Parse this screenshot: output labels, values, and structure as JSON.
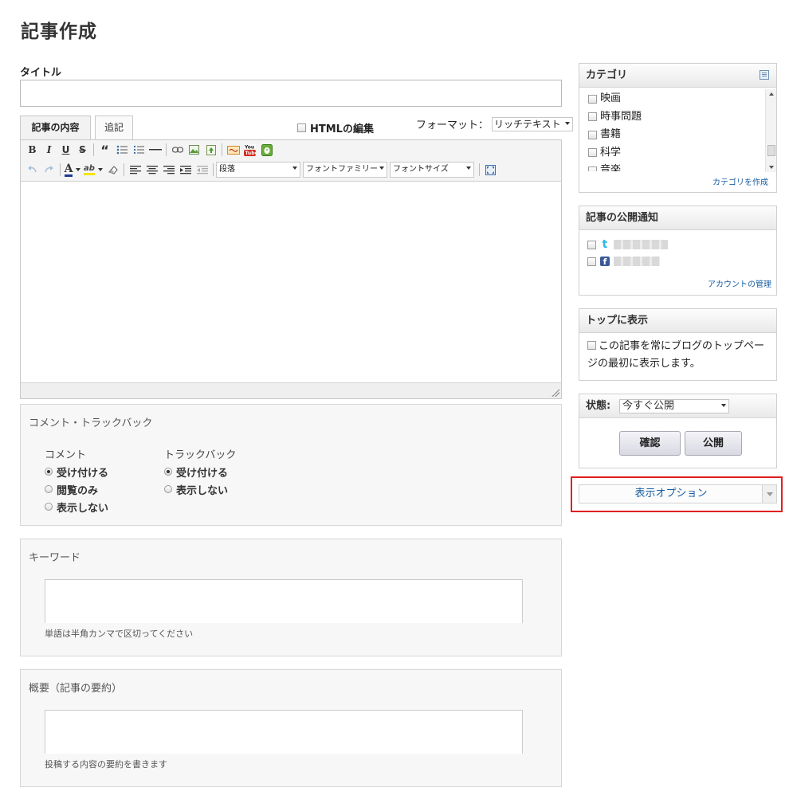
{
  "page": {
    "title": "記事作成"
  },
  "form": {
    "title_label": "タイトル",
    "title_value": ""
  },
  "editor": {
    "tabs": [
      {
        "label": "記事の内容"
      },
      {
        "label": "追記"
      }
    ],
    "html_edit_label": "HTMLの編集",
    "format_label": "フォーマット：",
    "format_value": "リッチテキスト",
    "toolbar": {
      "bold": "B",
      "italic": "I",
      "underline": "U",
      "strike": "S",
      "quote": "“",
      "paragraph": "段落",
      "font_family": "フォントファミリー",
      "font_size": "フォントサイズ",
      "text_color": "A",
      "highlight": "ab"
    }
  },
  "comments": {
    "title": "コメント・トラックバック",
    "comment_title": "コメント",
    "comment_options": [
      "受け付ける",
      "閲覧のみ",
      "表示しない"
    ],
    "trackback_title": "トラックバック",
    "trackback_options": [
      "受け付ける",
      "表示しない"
    ]
  },
  "keywords": {
    "title": "キーワード",
    "hint": "単語は半角カンマで区切ってください"
  },
  "summary": {
    "title": "概要（記事の要約）",
    "hint": "投稿する内容の要約を書きます"
  },
  "sidebar": {
    "category": {
      "title": "カテゴリ",
      "items": [
        "映画",
        "時事問題",
        "書籍",
        "科学",
        "音楽"
      ],
      "create_link": "カテゴリを作成"
    },
    "notify": {
      "title": "記事の公開通知",
      "manage_link": "アカウントの管理"
    },
    "top": {
      "title": "トップに表示",
      "text": "この記事を常にブログのトップページの最初に表示します。"
    },
    "state": {
      "label": "状態:",
      "value": "今すぐ公開",
      "confirm_button": "確認",
      "publish_button": "公開"
    },
    "display_options": "表示オプション"
  }
}
